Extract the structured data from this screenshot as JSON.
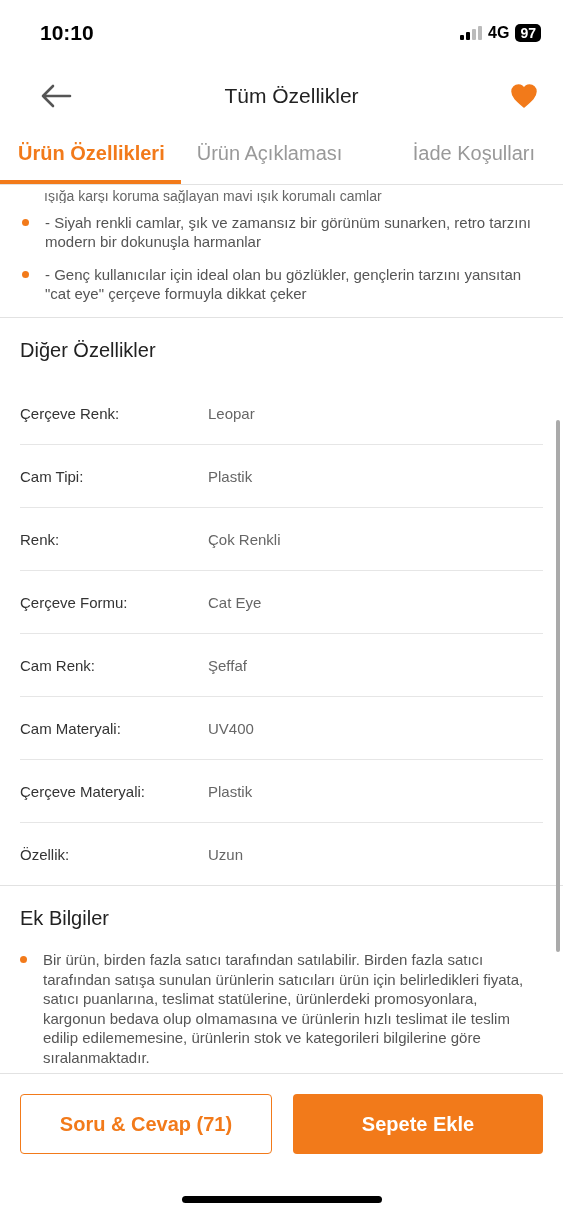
{
  "status_bar": {
    "time": "10:10",
    "network": "4G",
    "battery": "97"
  },
  "header": {
    "title": "Tüm Özellikler",
    "favorited": true
  },
  "tabs": [
    {
      "label": "Ürün Özellikleri",
      "selected": true
    },
    {
      "label": "Ürün Açıklaması",
      "selected": false
    },
    {
      "label": "İade Koşulları",
      "selected": false
    }
  ],
  "features": {
    "cut_line": "ışığa karşı koruma sağlayan mavi ışık korumalı camlar",
    "items": [
      "- Siyah renkli camlar, şık ve zamansız bir görünüm sunarken, retro tarzını modern bir dokunuşla harmanlar",
      "- Genç kullanıcılar için ideal olan bu gözlükler, gençlerin tarzını yansıtan \"cat eye\" çerçeve formuyla dikkat çeker"
    ]
  },
  "other_features": {
    "title": "Diğer Özellikler",
    "rows": [
      {
        "label": "Çerçeve Renk:",
        "value": "Leopar"
      },
      {
        "label": "Cam Tipi:",
        "value": "Plastik"
      },
      {
        "label": "Renk:",
        "value": "Çok Renkli"
      },
      {
        "label": "Çerçeve Formu:",
        "value": "Cat Eye"
      },
      {
        "label": "Cam Renk:",
        "value": "Şeffaf"
      },
      {
        "label": "Cam Materyali:",
        "value": "UV400"
      },
      {
        "label": "Çerçeve Materyali:",
        "value": "Plastik"
      },
      {
        "label": "Özellik:",
        "value": "Uzun"
      }
    ]
  },
  "extra_info": {
    "title": "Ek Bilgiler",
    "items": [
      "Bir ürün, birden fazla satıcı tarafından satılabilir. Birden fazla satıcı tarafından satışa sunulan ürünlerin satıcıları ürün için belirledikleri fiyata, satıcı puanlarına, teslimat statülerine, ürünlerdeki promosyonlara, kargonun bedava olup olmamasına ve ürünlerin hızlı teslimat ile teslim edilip edilememesine, ürünlerin stok ve kategorileri bilgilerine göre sıralanmaktadır."
    ]
  },
  "buttons": [
    {
      "label": "Soru & Cevap (71)",
      "kind": "outline"
    },
    {
      "label": "Sepete Ekle",
      "kind": "filled"
    }
  ]
}
